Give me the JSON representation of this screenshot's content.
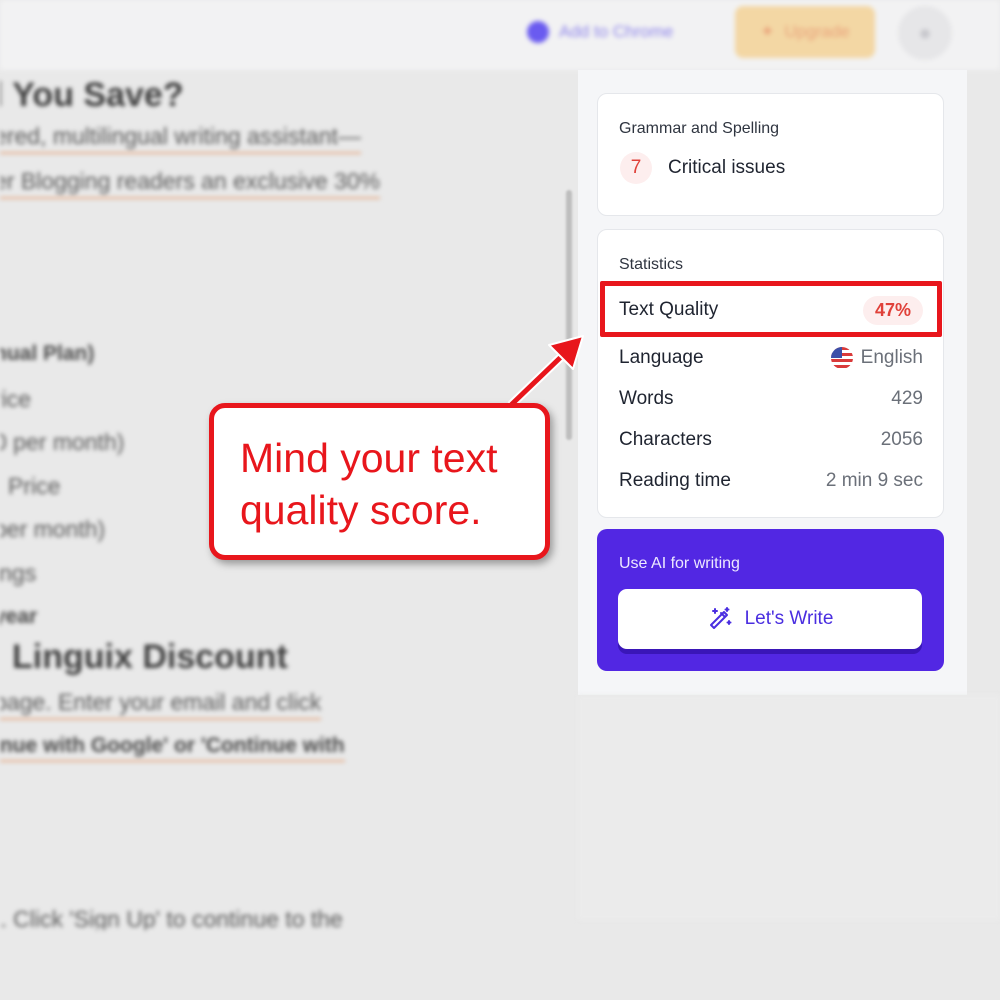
{
  "topbar": {
    "add_to_chrome_label": "Add to Chrome",
    "upgrade_label": "Upgrade"
  },
  "document": {
    "lines": [
      "l You Save?",
      "ered, multilingual writing assistant—",
      "er Blogging readers an exclusive 30%",
      "nual Plan)",
      "rice",
      "0 per month)",
      "Price",
      "per month)",
      "ings",
      "year",
      "Linguix Discount",
      "page. Enter your email and click",
      "inue with Google' or 'Continue with",
      "t. Click 'Sign Up' to continue to the"
    ]
  },
  "grammar_card": {
    "title": "Grammar and Spelling",
    "issue_count": "7",
    "issue_label": "Critical issues"
  },
  "stats_card": {
    "title": "Statistics",
    "rows": [
      {
        "label": "Text Quality",
        "value": "47%"
      },
      {
        "label": "Language",
        "value": "English"
      },
      {
        "label": "Words",
        "value": "429"
      },
      {
        "label": "Characters",
        "value": "2056"
      },
      {
        "label": "Reading time",
        "value": "2 min 9 sec"
      }
    ]
  },
  "ai_card": {
    "title": "Use AI for writing",
    "button_label": "Let's Write"
  },
  "callout": {
    "text": "Mind your text\nquality score."
  },
  "colors": {
    "annotation_red": "#e8161c",
    "ai_purple": "#5227e3",
    "quality_red": "#e0413a"
  },
  "icons": [
    "chrome-logo-icon",
    "sparkle-icon",
    "user-avatar-icon",
    "us-flag-icon",
    "magic-wand-icon"
  ]
}
